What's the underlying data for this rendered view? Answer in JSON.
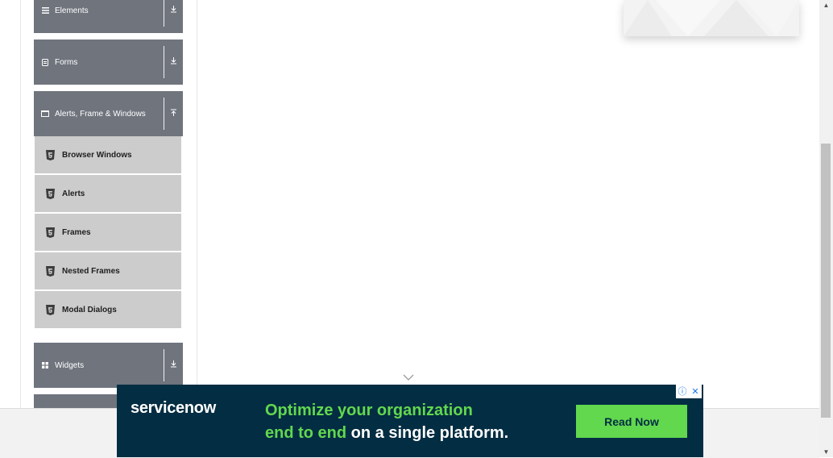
{
  "sidebar": {
    "groups": [
      {
        "label": "Elements",
        "icon": "hamburger-icon",
        "arrow": "download-arrow-icon"
      },
      {
        "label": "Forms",
        "icon": "form-icon",
        "arrow": "download-arrow-icon"
      },
      {
        "label": "Alerts, Frame & Windows",
        "icon": "window-icon",
        "arrow": "upload-arrow-icon"
      },
      {
        "label": "Widgets",
        "icon": "grid-icon",
        "arrow": "download-arrow-icon"
      }
    ],
    "items": [
      {
        "label": "Browser Windows",
        "icon": "html5-icon"
      },
      {
        "label": "Alerts",
        "icon": "html5-icon"
      },
      {
        "label": "Frames",
        "icon": "html5-icon"
      },
      {
        "label": "Nested Frames",
        "icon": "html5-icon"
      },
      {
        "label": "Modal Dialogs",
        "icon": "html5-icon"
      }
    ]
  },
  "ad": {
    "brand": "servicenow",
    "headline_green_1": "Optimize your organization",
    "headline_green_2": "end to end",
    "headline_white_2": " on a single platform.",
    "cta": "Read Now",
    "info_symbol": "ⓘ",
    "close_symbol": "✕",
    "colors": {
      "background": "#032d42",
      "accent": "#62d84e"
    }
  }
}
